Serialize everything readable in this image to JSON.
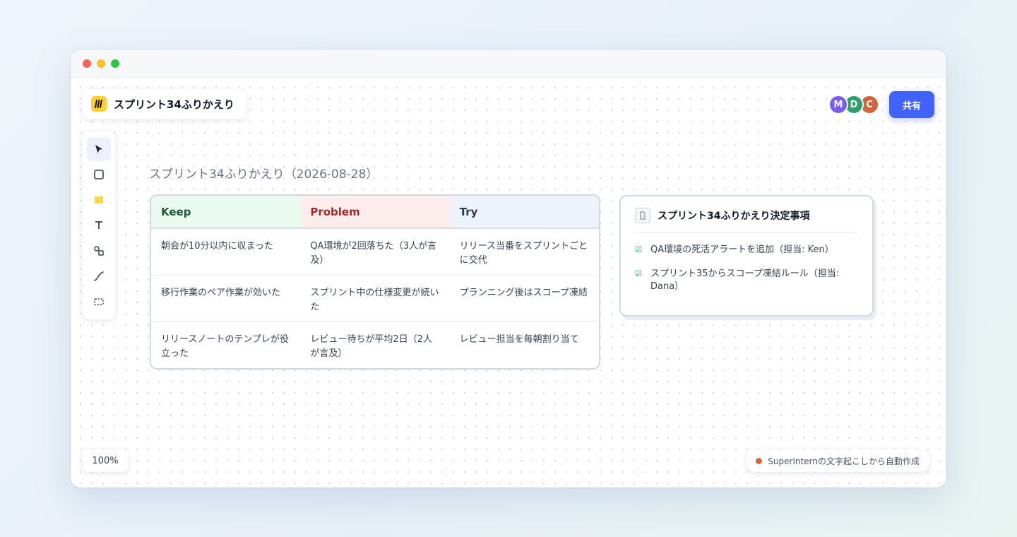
{
  "window": {
    "controls": {
      "close_color": "#ff5f57",
      "minimize_color": "#febc2e",
      "maximize_color": "#28c840"
    }
  },
  "board": {
    "title": "スプリント34ふりかえり",
    "logo_icon": "miro-logo-icon",
    "accent": "#4262ff"
  },
  "collaborators": [
    {
      "initial": "M",
      "color": "#7c5cf0"
    },
    {
      "initial": "D",
      "color": "#2f9e6e"
    },
    {
      "initial": "C",
      "color": "#d0643f"
    }
  ],
  "share_label": "共有",
  "toolbar": {
    "tools": [
      {
        "name": "select-tool",
        "icon": "cursor-icon",
        "active": true
      },
      {
        "name": "shape-tool",
        "icon": "square-icon"
      },
      {
        "name": "sticky-note-tool",
        "icon": "sticky-note-icon"
      },
      {
        "name": "text-tool",
        "icon": "text-icon"
      },
      {
        "name": "connector-tool",
        "icon": "shapes-icon"
      },
      {
        "name": "pen-tool",
        "icon": "pen-line-icon"
      },
      {
        "name": "frame-tool",
        "icon": "frame-icon"
      }
    ]
  },
  "frame": {
    "title": "スプリント34ふりかえり（2026-08-28）"
  },
  "kpt": {
    "headers": [
      {
        "label": "Keep",
        "bg": "#eafaf1",
        "color": "#1e5a3a"
      },
      {
        "label": "Problem",
        "bg": "#fdecec",
        "color": "#9b2c2c"
      },
      {
        "label": "Try",
        "bg": "#eef2fb",
        "color": "#2a3b55"
      }
    ],
    "rows": [
      [
        "朝会が10分以内に収まった",
        "QA環境が2回落ちた（3人が言及）",
        "リリース当番をスプリントごとに交代"
      ],
      [
        "移行作業のペア作業が効いた",
        "スプリント中の仕様変更が続いた",
        "プランニング後はスコープ凍結"
      ],
      [
        "リリースノートのテンプレが役立った",
        "レビュー待ちが平均2日（2人が言及）",
        "レビュー担当を毎朝割り当て"
      ]
    ]
  },
  "decisions": {
    "title": "スプリント34ふりかえり決定事項",
    "icon": "document-icon",
    "items": [
      "QA環境の死活アラートを追加（担当: Ken）",
      "スプリント35からスコープ凍結ルール（担当: Dana）"
    ]
  },
  "zoom": "100%",
  "footer_note": "SuperInternの文字起こしから自動作成"
}
